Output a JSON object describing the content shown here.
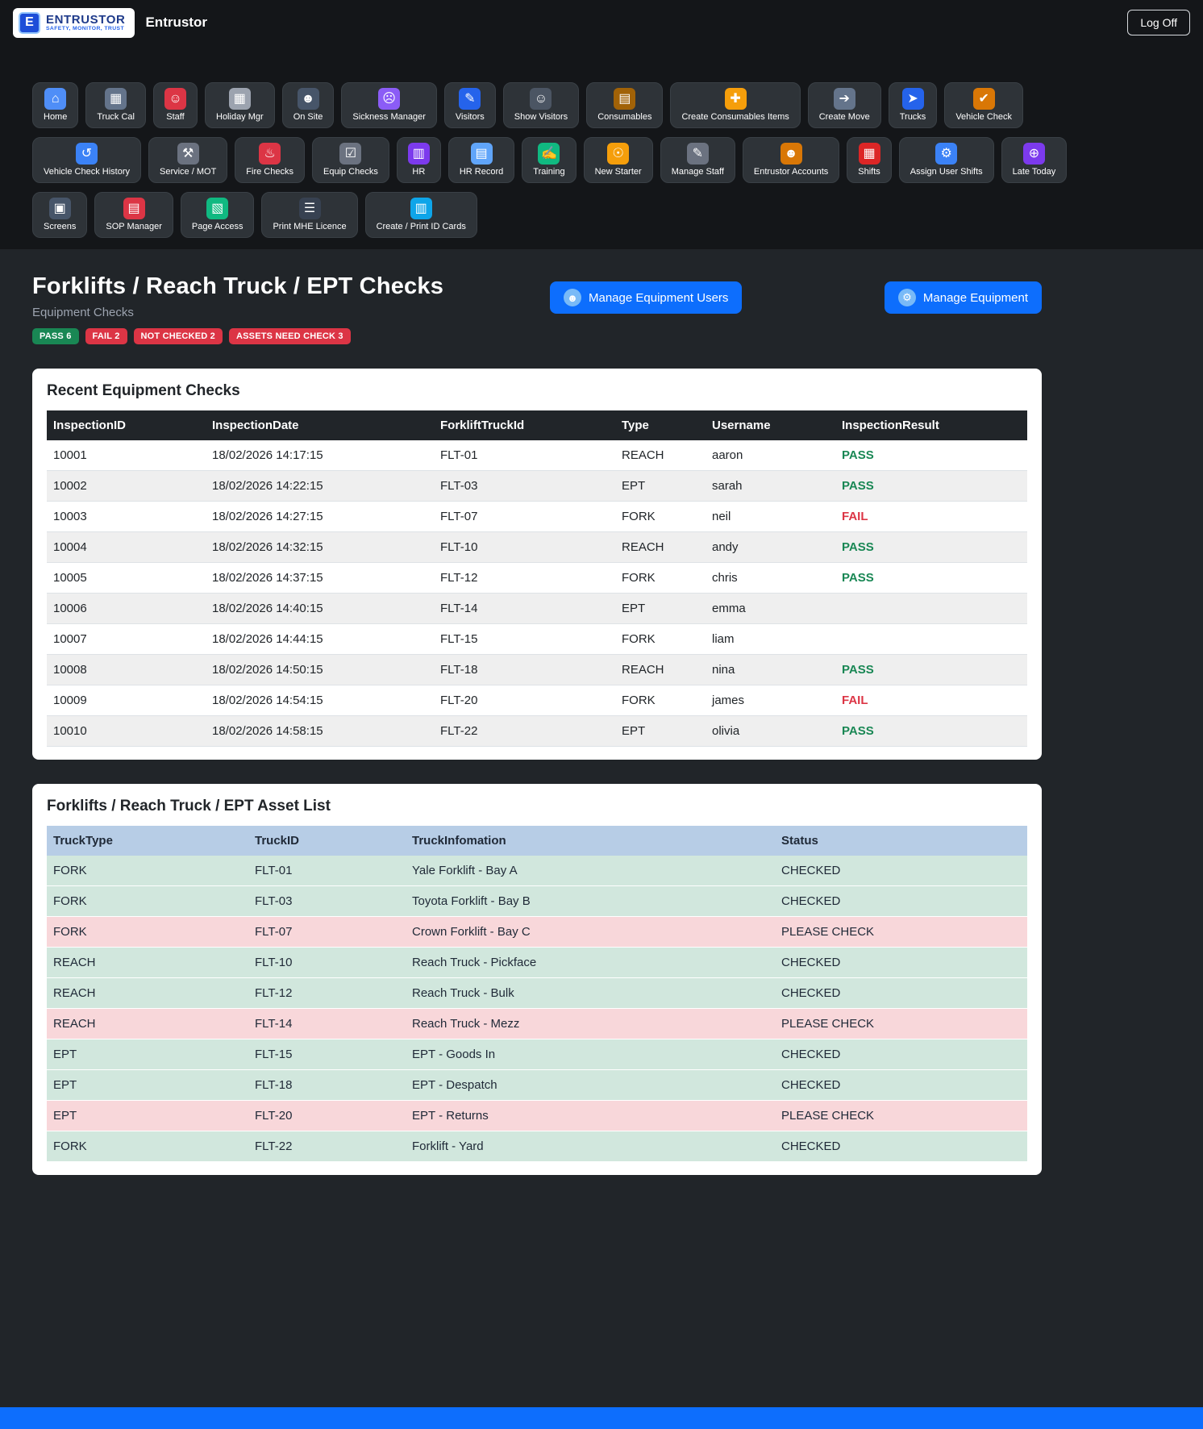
{
  "header": {
    "logo": {
      "letter": "E",
      "name": "ENTRUSTOR",
      "tagline": "SAFETY, MONITOR, TRUST"
    },
    "brand": "Entrustor",
    "log_off_label": "Log Off"
  },
  "nav": {
    "rows": [
      [
        {
          "id": "home",
          "label": "Home",
          "glyph": "⌂",
          "color": "#4f8ef7"
        },
        {
          "id": "truck-cal",
          "label": "Truck Cal",
          "glyph": "▦",
          "color": "#64748b"
        },
        {
          "id": "staff",
          "label": "Staff",
          "glyph": "☺",
          "color": "#dc3545"
        },
        {
          "id": "holiday-mgr",
          "label": "Holiday Mgr",
          "glyph": "▦",
          "color": "#9ca3af"
        },
        {
          "id": "on-site",
          "label": "On Site",
          "glyph": "☻",
          "color": "#475569"
        },
        {
          "id": "sickness-manager",
          "label": "Sickness Manager",
          "glyph": "☹",
          "color": "#8b5cf6"
        },
        {
          "id": "visitors",
          "label": "Visitors",
          "glyph": "✎",
          "color": "#2563eb"
        },
        {
          "id": "show-visitors",
          "label": "Show Visitors",
          "glyph": "☺",
          "color": "#4b5563"
        },
        {
          "id": "consumables",
          "label": "Consumables",
          "glyph": "▤",
          "color": "#a16207"
        },
        {
          "id": "create-consumables-items",
          "label": "Create Consumables Items",
          "glyph": "✚",
          "color": "#f59e0b"
        },
        {
          "id": "create-move",
          "label": "Create Move",
          "glyph": "➔",
          "color": "#64748b"
        },
        {
          "id": "trucks",
          "label": "Trucks",
          "glyph": "➤",
          "color": "#2563eb"
        },
        {
          "id": "vehicle-check",
          "label": "Vehicle Check",
          "glyph": "✔",
          "color": "#d97706"
        }
      ],
      [
        {
          "id": "vehicle-check-history",
          "label": "Vehicle Check History",
          "glyph": "↺",
          "color": "#3b82f6"
        },
        {
          "id": "service-mot",
          "label": "Service / MOT",
          "glyph": "⚒",
          "color": "#6b7280"
        },
        {
          "id": "fire-checks",
          "label": "Fire Checks",
          "glyph": "♨",
          "color": "#dc3545"
        },
        {
          "id": "equip-checks",
          "label": "Equip Checks",
          "glyph": "☑",
          "color": "#6b7280"
        },
        {
          "id": "hr",
          "label": "HR",
          "glyph": "▥",
          "color": "#7c3aed"
        },
        {
          "id": "hr-record",
          "label": "HR Record",
          "glyph": "▤",
          "color": "#60a5fa"
        },
        {
          "id": "training",
          "label": "Training",
          "glyph": "✍",
          "color": "#10b981"
        },
        {
          "id": "new-starter",
          "label": "New Starter",
          "glyph": "☉",
          "color": "#f59e0b"
        },
        {
          "id": "manage-staff",
          "label": "Manage Staff",
          "glyph": "✎",
          "color": "#6b7280"
        },
        {
          "id": "entrustor-accounts",
          "label": "Entrustor Accounts",
          "glyph": "☻",
          "color": "#d97706"
        },
        {
          "id": "shifts",
          "label": "Shifts",
          "glyph": "▦",
          "color": "#dc2626"
        },
        {
          "id": "assign-user-shifts",
          "label": "Assign User Shifts",
          "glyph": "⚙",
          "color": "#3b82f6"
        },
        {
          "id": "late-today",
          "label": "Late Today",
          "glyph": "⊕",
          "color": "#7c3aed"
        }
      ],
      [
        {
          "id": "screens",
          "label": "Screens",
          "glyph": "▣",
          "color": "#475569"
        },
        {
          "id": "sop-manager",
          "label": "SOP Manager",
          "glyph": "▤",
          "color": "#dc3545"
        },
        {
          "id": "page-access",
          "label": "Page Access",
          "glyph": "▧",
          "color": "#10b981"
        },
        {
          "id": "print-mhe-licence",
          "label": "Print MHE Licence",
          "glyph": "☰",
          "color": "#374151"
        },
        {
          "id": "create-print-id-cards",
          "label": "Create / Print ID Cards",
          "glyph": "▥",
          "color": "#0ea5e9"
        }
      ]
    ]
  },
  "page": {
    "title": "Forklifts / Reach Truck / EPT Checks",
    "subtitle": "Equipment Checks",
    "badges": [
      {
        "label": "PASS 6",
        "color": "#198754"
      },
      {
        "label": "FAIL 2",
        "color": "#dc3545"
      },
      {
        "label": "NOT CHECKED 2",
        "color": "#dc3545"
      },
      {
        "label": "ASSETS NEED CHECK 3",
        "color": "#dc3545"
      }
    ],
    "manage_users_label": "Manage Equipment Users",
    "manage_users_icon": "☻",
    "manage_equipment_label": "Manage Equipment",
    "manage_equipment_icon": "⚙"
  },
  "recent_checks": {
    "title": "Recent Equipment Checks",
    "columns": [
      "InspectionID",
      "InspectionDate",
      "ForkliftTruckId",
      "Type",
      "Username",
      "InspectionResult"
    ],
    "rows": [
      [
        "10001",
        "18/02/2026 14:17:15",
        "FLT-01",
        "REACH",
        "aaron",
        "PASS"
      ],
      [
        "10002",
        "18/02/2026 14:22:15",
        "FLT-03",
        "EPT",
        "sarah",
        "PASS"
      ],
      [
        "10003",
        "18/02/2026 14:27:15",
        "FLT-07",
        "FORK",
        "neil",
        "FAIL"
      ],
      [
        "10004",
        "18/02/2026 14:32:15",
        "FLT-10",
        "REACH",
        "andy",
        "PASS"
      ],
      [
        "10005",
        "18/02/2026 14:37:15",
        "FLT-12",
        "FORK",
        "chris",
        "PASS"
      ],
      [
        "10006",
        "18/02/2026 14:40:15",
        "FLT-14",
        "EPT",
        "emma",
        ""
      ],
      [
        "10007",
        "18/02/2026 14:44:15",
        "FLT-15",
        "FORK",
        "liam",
        ""
      ],
      [
        "10008",
        "18/02/2026 14:50:15",
        "FLT-18",
        "REACH",
        "nina",
        "PASS"
      ],
      [
        "10009",
        "18/02/2026 14:54:15",
        "FLT-20",
        "FORK",
        "james",
        "FAIL"
      ],
      [
        "10010",
        "18/02/2026 14:58:15",
        "FLT-22",
        "EPT",
        "olivia",
        "PASS"
      ]
    ],
    "result_colors": {
      "PASS": "#198754",
      "FAIL": "#dc3545"
    }
  },
  "asset_list": {
    "title": "Forklifts / Reach Truck / EPT Asset List",
    "columns": [
      "TruckType",
      "TruckID",
      "TruckInfomation",
      "Status"
    ],
    "rows": [
      [
        "FORK",
        "FLT-01",
        "Yale Forklift - Bay A",
        "CHECKED"
      ],
      [
        "FORK",
        "FLT-03",
        "Toyota Forklift - Bay B",
        "CHECKED"
      ],
      [
        "FORK",
        "FLT-07",
        "Crown Forklift - Bay C",
        "PLEASE CHECK"
      ],
      [
        "REACH",
        "FLT-10",
        "Reach Truck - Pickface",
        "CHECKED"
      ],
      [
        "REACH",
        "FLT-12",
        "Reach Truck - Bulk",
        "CHECKED"
      ],
      [
        "REACH",
        "FLT-14",
        "Reach Truck - Mezz",
        "PLEASE CHECK"
      ],
      [
        "EPT",
        "FLT-15",
        "EPT - Goods In",
        "CHECKED"
      ],
      [
        "EPT",
        "FLT-18",
        "EPT - Despatch",
        "CHECKED"
      ],
      [
        "EPT",
        "FLT-20",
        "EPT - Returns",
        "PLEASE CHECK"
      ],
      [
        "FORK",
        "FLT-22",
        "Forklift - Yard",
        "CHECKED"
      ]
    ],
    "status_colors": {
      "CHECKED": "#d1e7dd",
      "PLEASE CHECK": "#f8d7da"
    }
  }
}
